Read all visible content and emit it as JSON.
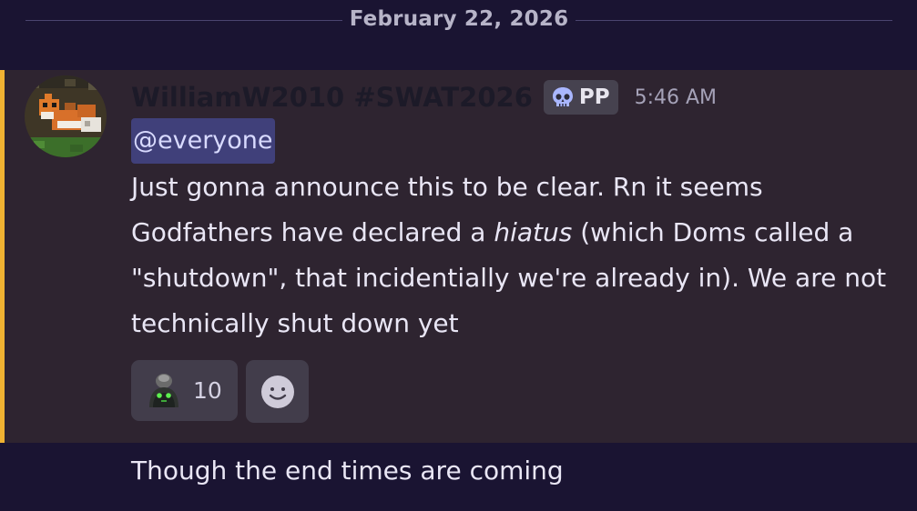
{
  "date_divider": {
    "label": "February 22, 2026"
  },
  "message": {
    "author": "WilliamW2010 #SWAT2026",
    "role_tag": {
      "label": "PP",
      "icon": "skull-icon"
    },
    "timestamp": "5:46 AM",
    "mention": "@everyone",
    "body": {
      "part1": "Just gonna announce this to be clear. Rn it seems Godfathers have declared a ",
      "italic": "hiatus",
      "part2": " (which Doms called a \"shutdown\", that incidentially we're already in). We are not technically shut down yet"
    },
    "reactions": [
      {
        "emoji": "dark-figure-emoji",
        "count": "10"
      }
    ],
    "add_reaction_icon": "smiley-face-icon",
    "mention_highlight_color": "#f0b232"
  },
  "followup_message": {
    "text": "Though the end times are coming"
  },
  "colors": {
    "background": "#1a1432",
    "highlighted_message": "#2e2430",
    "mention_pill": "#40407a"
  }
}
